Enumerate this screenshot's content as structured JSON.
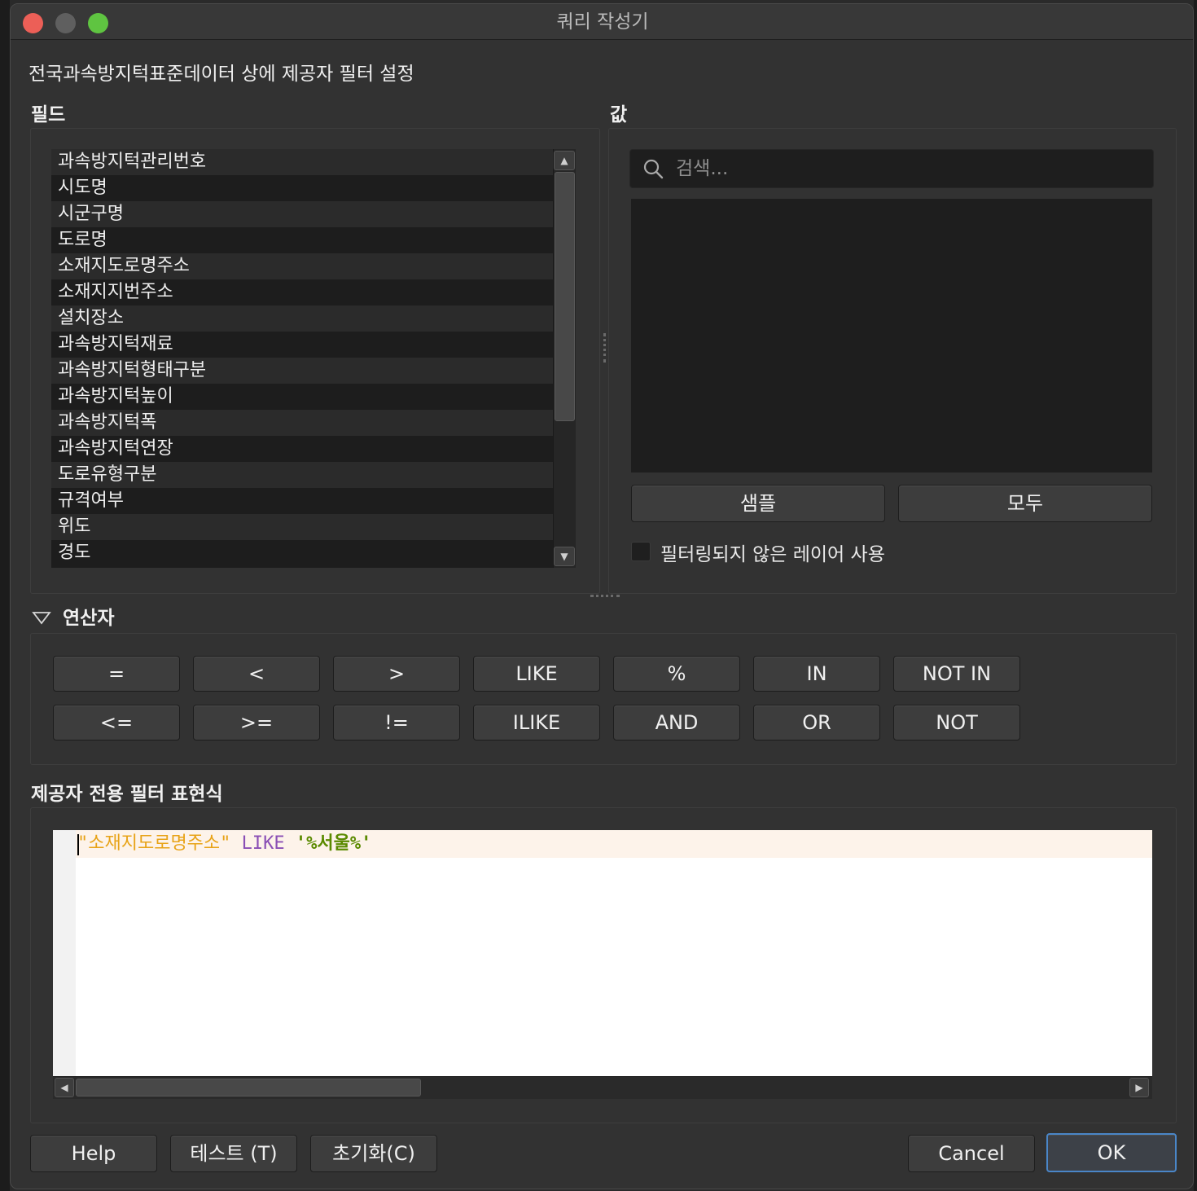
{
  "window": {
    "title": "쿼리 작성기",
    "traffic_lights": {
      "close": "#ec5f57",
      "minimize": "#5f5f5f",
      "zoom": "#5fc441"
    }
  },
  "subtitle": "전국과속방지턱표준데이터 상에 제공자 필터 설정",
  "fields_panel": {
    "label": "필드",
    "items": [
      "과속방지턱관리번호",
      "시도명",
      "시군구명",
      "도로명",
      "소재지도로명주소",
      "소재지지번주소",
      "설치장소",
      "과속방지턱재료",
      "과속방지턱형태구분",
      "과속방지턱높이",
      "과속방지턱폭",
      "과속방지턱연장",
      "도로유형구분",
      "규격여부",
      "위도",
      "경도"
    ]
  },
  "values_panel": {
    "label": "값",
    "search_placeholder": "검색...",
    "sample_button": "샘플",
    "all_button": "모두",
    "use_unfiltered_layer": "필터링되지 않은 레이어 사용",
    "use_unfiltered_checked": false
  },
  "operators": {
    "label": "연산자",
    "expanded": true,
    "row1": [
      "=",
      "<",
      ">",
      "LIKE",
      "%",
      "IN",
      "NOT IN"
    ],
    "row2": [
      "<=",
      ">=",
      "!=",
      "ILIKE",
      "AND",
      "OR",
      "NOT"
    ]
  },
  "expression": {
    "label": "제공자 전용 필터 표현식",
    "field_token": "\"소재지도로명주소\"",
    "operator_token": "LIKE",
    "value_token": "'%서울%'",
    "colors": {
      "field": "#e8a317",
      "operator": "#8a4fb5",
      "value": "#5a8a00"
    }
  },
  "footer": {
    "help": "Help",
    "test": "테스트 (T)",
    "reset": "초기화(C)",
    "cancel": "Cancel",
    "ok": "OK"
  }
}
